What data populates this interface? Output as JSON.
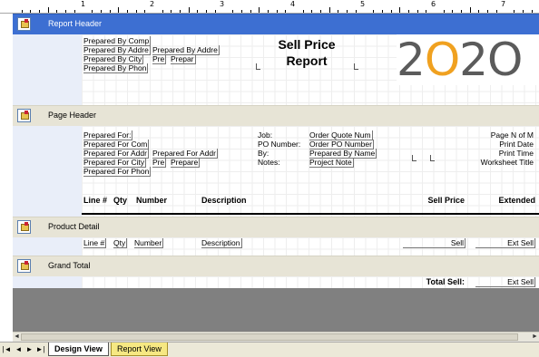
{
  "ruler": {
    "numbers": [
      "1",
      "2",
      "3",
      "4",
      "5",
      "6",
      "7"
    ]
  },
  "sections": {
    "report_header": "Report Header",
    "page_header": "Page Header",
    "product_detail": "Product Detail",
    "grand_total": "Grand Total"
  },
  "report_header": {
    "fields": [
      "Prepared By Comp",
      "Prepared By Addre",
      "Prepared By City",
      "Prepared By Phon"
    ],
    "addr_field": "Prepared By Addre",
    "city_pre": "Pre",
    "city_prepar": "Prepar",
    "title_line1": "Sell Price",
    "title_line2": "Report",
    "logo": {
      "part1": "2",
      "part2": "O",
      "part3": "2",
      "part4": "O"
    }
  },
  "page_header": {
    "left_fields": [
      "Prepared For:",
      "Prepared For Com",
      "Prepared For Addr",
      "Prepared For City",
      "Prepared For Phon"
    ],
    "for_addr": "Prepared For Addr",
    "city_pre": "Pre",
    "city_prepare": "Prepare",
    "mid_labels": [
      "Job:",
      "PO Number:",
      "By:",
      "Notes:"
    ],
    "mid_values": [
      "Order Quote Num",
      "Order PO Number",
      "Prepared By Name",
      "Project Note"
    ],
    "right_fields": [
      "Page N of M",
      "Print Date",
      "Print Time",
      "Worksheet Title"
    ],
    "columns": {
      "line": "Line #",
      "qty": "Qty",
      "number": "Number",
      "description": "Description",
      "sell_price": "Sell Price",
      "extended": "Extended"
    }
  },
  "detail": {
    "line": "Line #",
    "qty": "Qty",
    "number": "Number",
    "description": "Description",
    "sell": "Sell",
    "ext_sell": "Ext Sell"
  },
  "grand_total": {
    "label": "Total Sell:",
    "value": "Ext Sell"
  },
  "tabs": {
    "design": "Design View",
    "report": "Report View"
  },
  "nav": {
    "first": "|◄",
    "prev": "◄",
    "next": "►",
    "last": "►|"
  }
}
